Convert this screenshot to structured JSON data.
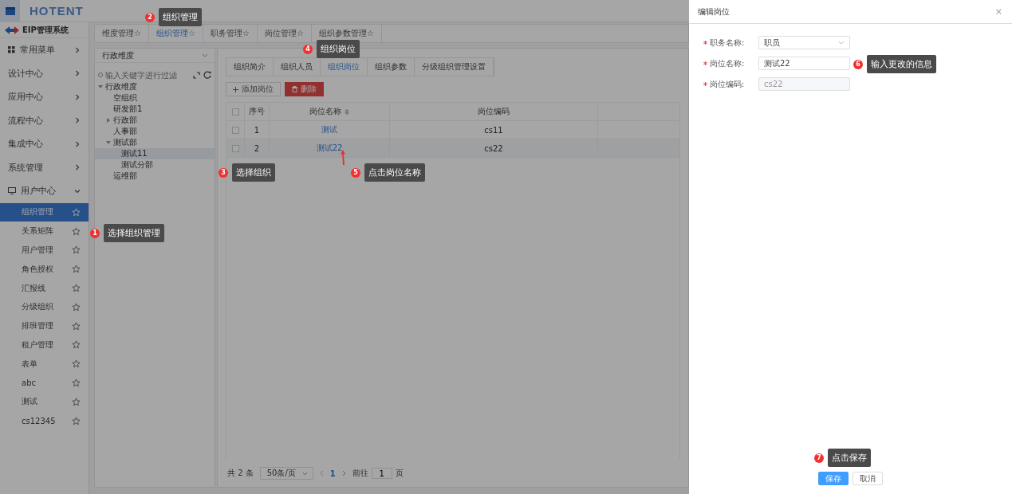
{
  "header": {
    "logo": "HOTENT"
  },
  "sidebar": {
    "system_name": "EIP管理系统",
    "items": [
      {
        "label": "常用菜单",
        "kind": "group",
        "expanded": false
      },
      {
        "label": "设计中心",
        "kind": "group",
        "expanded": false
      },
      {
        "label": "应用中心",
        "kind": "group",
        "expanded": false
      },
      {
        "label": "流程中心",
        "kind": "group",
        "expanded": false
      },
      {
        "label": "集成中心",
        "kind": "group",
        "expanded": false
      },
      {
        "label": "系统管理",
        "kind": "group",
        "expanded": false
      },
      {
        "label": "用户中心",
        "kind": "group",
        "expanded": true,
        "children": [
          {
            "label": "组织管理",
            "selected": true
          },
          {
            "label": "关系矩阵",
            "selected": false
          },
          {
            "label": "用户管理",
            "selected": false
          },
          {
            "label": "角色授权",
            "selected": false
          },
          {
            "label": "汇报线",
            "selected": false
          },
          {
            "label": "分级组织",
            "selected": false
          },
          {
            "label": "排班管理",
            "selected": false
          },
          {
            "label": "租户管理",
            "selected": false
          },
          {
            "label": "表单",
            "selected": false
          },
          {
            "label": "abc",
            "selected": false
          },
          {
            "label": "测试",
            "selected": false
          },
          {
            "label": "cs12345",
            "selected": false
          }
        ]
      }
    ]
  },
  "top_tabs": [
    {
      "label": "维度管理☆",
      "selected": false
    },
    {
      "label": "组织管理☆",
      "selected": true
    },
    {
      "label": "职务管理☆",
      "selected": false
    },
    {
      "label": "岗位管理☆",
      "selected": false
    },
    {
      "label": "组织参数管理☆",
      "selected": false
    }
  ],
  "tree": {
    "dimension": "行政维度",
    "filter_placeholder": "输入关键字进行过滤",
    "nodes": [
      {
        "label": "行政维度",
        "expanded": true,
        "selected": false,
        "children": [
          {
            "label": "空组织",
            "selected": false
          },
          {
            "label": "研发部1",
            "selected": false
          },
          {
            "label": "行政部",
            "expanded": false,
            "selected": false
          },
          {
            "label": "人事部",
            "selected": false
          },
          {
            "label": "测试部",
            "expanded": true,
            "selected": false,
            "children": [
              {
                "label": "测试11",
                "selected": true
              },
              {
                "label": "测试分部",
                "selected": false
              }
            ]
          },
          {
            "label": "运维部",
            "selected": false
          }
        ]
      }
    ]
  },
  "org_tabs": [
    {
      "label": "组织简介",
      "selected": false
    },
    {
      "label": "组织人员",
      "selected": false
    },
    {
      "label": "组织岗位",
      "selected": true
    },
    {
      "label": "组织参数",
      "selected": false
    },
    {
      "label": "分级组织管理设置",
      "selected": false
    }
  ],
  "toolbar": {
    "add": "添加岗位",
    "delete": "删除"
  },
  "table": {
    "select_all_checked": false,
    "columns": [
      "序号",
      "岗位名称",
      "岗位编码"
    ],
    "rows": [
      {
        "index": "1",
        "name": "测试",
        "code": "cs11",
        "checked": false
      },
      {
        "index": "2",
        "name": "测试22",
        "code": "cs22",
        "checked": false
      }
    ]
  },
  "pagination": {
    "total": "共 2 条",
    "page_size": "50条/页",
    "page": "1",
    "goto": "前往",
    "goto_value": "1",
    "page_unit": "页"
  },
  "drawer": {
    "title": "编辑岗位",
    "close": "×",
    "fields": [
      {
        "label": "职务名称:",
        "kind": "select",
        "value": "职员",
        "required": true
      },
      {
        "label": "岗位名称:",
        "kind": "input",
        "value": "测试22",
        "required": true
      },
      {
        "label": "岗位编码:",
        "kind": "disabled",
        "value": "cs22",
        "required": true
      }
    ],
    "buttons": [
      {
        "label": "保存",
        "kind": "primary"
      },
      {
        "label": "取消",
        "kind": "plain"
      }
    ]
  },
  "callouts": [
    {
      "number": "1",
      "text": "选择组织管理"
    },
    {
      "number": "2",
      "text": "组织管理"
    },
    {
      "number": "3",
      "text": "选择组织"
    },
    {
      "number": "4",
      "text": "组织岗位"
    },
    {
      "number": "5",
      "text": "点击岗位名称"
    },
    {
      "number": "6",
      "text": "输入更改的信息"
    },
    {
      "number": "7",
      "text": "点击保存"
    }
  ]
}
